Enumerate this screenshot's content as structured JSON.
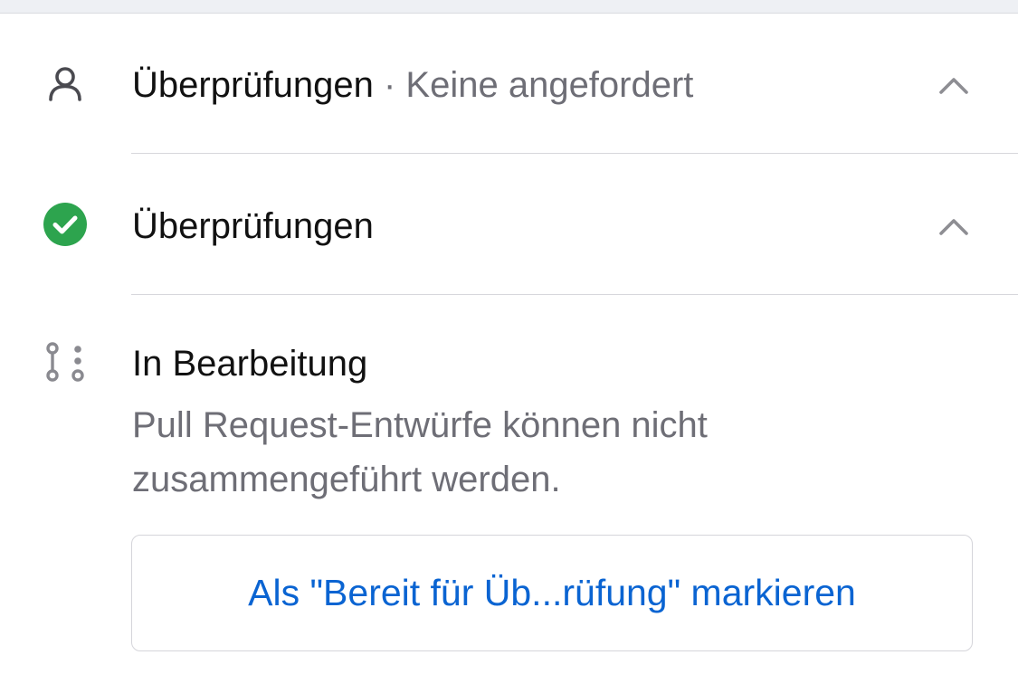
{
  "reviews": {
    "title": "Überprüfungen",
    "separator": " · ",
    "status": "Keine angefordert",
    "icon": "person-icon"
  },
  "checks": {
    "title": "Überprüfungen",
    "icon": "check-circle-icon",
    "icon_color": "#2da44e"
  },
  "draft": {
    "title": "In Bearbeitung",
    "icon": "git-pull-request-draft-icon",
    "description_line1": "Pull Request-Entwürfe können nicht",
    "description_line2": "zusammengeführt werden.",
    "button_label": "Als \"Bereit für Üb...rüfung\" markieren"
  },
  "colors": {
    "link_blue": "#0a64d2",
    "secondary_text": "#6e6e76",
    "chevron": "#8e8e93"
  }
}
